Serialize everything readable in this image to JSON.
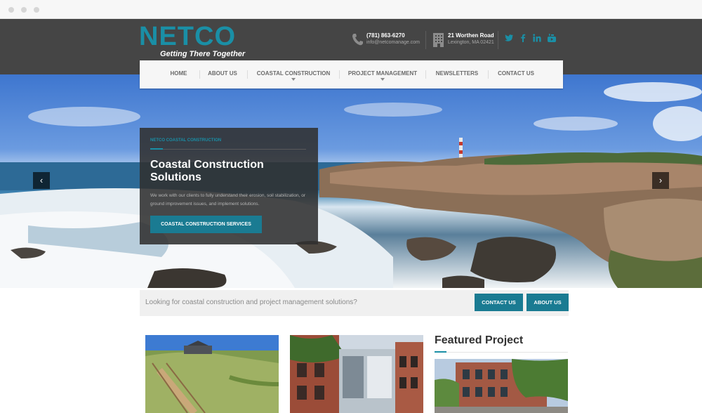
{
  "browser": {
    "controls": [
      "close",
      "minimize",
      "maximize"
    ]
  },
  "header": {
    "logo_text": "NETCO",
    "logo_tagline": "Getting There Together",
    "phone": {
      "icon": "phone-icon",
      "number": "(781) 863-6270",
      "email": "info@netcomanage.com"
    },
    "address": {
      "icon": "building-icon",
      "street": "21 Worthen Road",
      "city": "Lexington, MA 02421"
    },
    "social": [
      {
        "name": "twitter-icon",
        "glyph": "𝕥"
      },
      {
        "name": "facebook-icon",
        "glyph": "f"
      },
      {
        "name": "linkedin-icon",
        "glyph": "in"
      },
      {
        "name": "youtube-icon",
        "glyph": "▶"
      }
    ],
    "brand_color": "#1a8fa6",
    "header_bg": "#454545"
  },
  "nav": {
    "items": [
      {
        "label": "HOME",
        "dropdown": false
      },
      {
        "label": "ABOUT US",
        "dropdown": false
      },
      {
        "label": "COASTAL CONSTRUCTION",
        "dropdown": true
      },
      {
        "label": "PROJECT MANAGEMENT",
        "dropdown": true
      },
      {
        "label": "NEWSLETTERS",
        "dropdown": false
      },
      {
        "label": "CONTACT US",
        "dropdown": false
      }
    ]
  },
  "slider": {
    "prev_icon": "chevron-left-icon",
    "next_icon": "chevron-right-icon",
    "prev_glyph": "‹",
    "next_glyph": "›",
    "kicker": "NETCO COASTAL CONSTRUCTION",
    "title": "Coastal Construction Solutions",
    "text": "We work with our clients to fully understand their erosion, soil stabilization, or ground improvement issues, and implement solutions.",
    "button_label": "COASTAL CONSTRUCTION SERVICES"
  },
  "cta": {
    "text": "Looking for coastal construction and project management solutions?",
    "contact_label": "CONTACT US",
    "about_label": "ABOUT US"
  },
  "featured": {
    "title": "Featured Project"
  },
  "accent_color": "#1a7b92"
}
